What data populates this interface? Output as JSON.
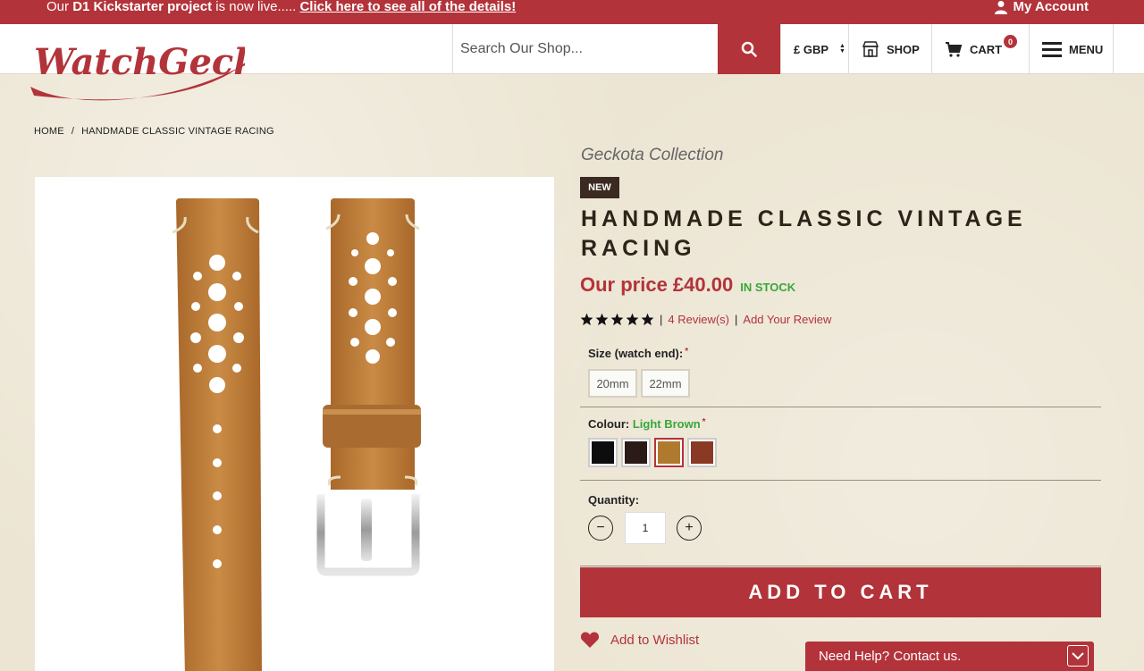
{
  "promo": {
    "prefix": "Our ",
    "project": "D1 Kickstarter project",
    "middle": " is now live..... ",
    "link": "Click here to see all of the details!",
    "account": "My Account"
  },
  "header": {
    "logo_text": "WatchGecko",
    "search_placeholder": "Search Our Shop...",
    "currency": "£ GBP",
    "shop": "SHOP",
    "cart": "CART",
    "cart_count": "0",
    "menu": "MENU"
  },
  "breadcrumb": {
    "home": "HOME",
    "separator": "/",
    "current": "HANDMADE CLASSIC VINTAGE RACING"
  },
  "product": {
    "collection": "Geckota Collection",
    "badge": "NEW",
    "title": "HANDMADE CLASSIC VINTAGE RACING",
    "price": "Our price £40.00",
    "stock": "IN STOCK",
    "rating_stars": 5,
    "reviews": "4 Review(s)",
    "add_review": "Add Your Review",
    "divider": "|"
  },
  "options": {
    "size_label": "Size (watch end):",
    "sizes": [
      "20mm",
      "22mm"
    ],
    "colour_label": "Colour:",
    "colour_value": "Light Brown",
    "required_mark": "*",
    "swatch_colors": [
      "#0d0d0d",
      "#2a1a18",
      "#b07a2e",
      "#8a3a24"
    ],
    "selected_swatch": 2,
    "quantity_label": "Quantity:",
    "quantity": "1",
    "minus": "−",
    "plus": "+"
  },
  "actions": {
    "add_to_cart": "ADD TO CART",
    "wishlist": "Add to Wishlist"
  },
  "help": {
    "label": "Need Help? Contact us."
  },
  "colors": {
    "brand_red": "#b3333a",
    "stock_green": "#3aa63a",
    "background": "#ece5d3"
  }
}
